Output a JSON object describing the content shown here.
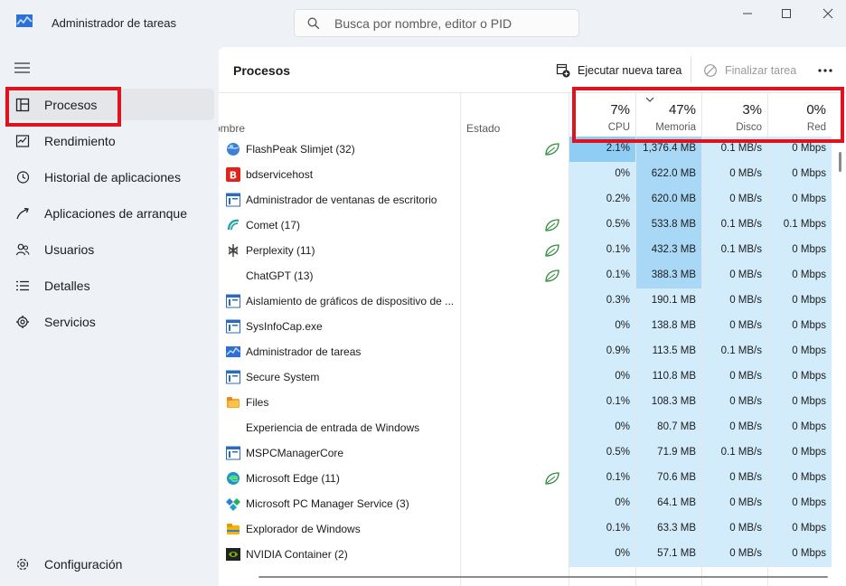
{
  "window": {
    "title": "Administrador de tareas",
    "search_placeholder": "Busca por nombre, editor o PID"
  },
  "sidebar": {
    "items": [
      {
        "label": "Procesos",
        "icon": "processes-icon",
        "active": true
      },
      {
        "label": "Rendimiento",
        "icon": "performance-icon"
      },
      {
        "label": "Historial de aplicaciones",
        "icon": "history-icon"
      },
      {
        "label": "Aplicaciones de arranque",
        "icon": "startup-icon"
      },
      {
        "label": "Usuarios",
        "icon": "users-icon"
      },
      {
        "label": "Detalles",
        "icon": "details-icon"
      },
      {
        "label": "Servicios",
        "icon": "services-icon"
      }
    ],
    "settings_label": "Configuración"
  },
  "toolbar": {
    "title": "Procesos",
    "run_task": "Ejecutar nueva tarea",
    "end_task": "Finalizar tarea"
  },
  "columns": {
    "name": "ombre",
    "status": "Estado",
    "cpu": {
      "pct": "7%",
      "label": "CPU"
    },
    "memory": {
      "pct": "47%",
      "label": "Memoria"
    },
    "disk": {
      "pct": "3%",
      "label": "Disco"
    },
    "network": {
      "pct": "0%",
      "label": "Red"
    }
  },
  "colors": {
    "highlight": "#e0121e",
    "heat_light": "#d3ecfb",
    "heat_mid": "#a9d8f6",
    "heat_strong": "#90cdf4",
    "efficiency_leaf": "#2f8a3c"
  },
  "processes": [
    {
      "name": "FlashPeak Slimjet (32)",
      "icon": "slimjet-globe-icon",
      "eco": true,
      "cpu": "2.1%",
      "mem": "1,376.4 MB",
      "disk": "0.1 MB/s",
      "net": "0 Mbps"
    },
    {
      "name": "bdservicehost",
      "icon": "bitdefender-icon",
      "eco": false,
      "cpu": "0%",
      "mem": "622.0 MB",
      "disk": "0 MB/s",
      "net": "0 Mbps"
    },
    {
      "name": "Administrador de ventanas de escritorio",
      "icon": "window-app-icon",
      "eco": false,
      "cpu": "0.2%",
      "mem": "620.0 MB",
      "disk": "0 MB/s",
      "net": "0 Mbps"
    },
    {
      "name": "Comet (17)",
      "icon": "comet-icon",
      "eco": true,
      "cpu": "0.5%",
      "mem": "533.8 MB",
      "disk": "0.1 MB/s",
      "net": "0.1 Mbps"
    },
    {
      "name": "Perplexity (11)",
      "icon": "perplexity-icon",
      "eco": true,
      "cpu": "0.1%",
      "mem": "432.3 MB",
      "disk": "0.1 MB/s",
      "net": "0 Mbps"
    },
    {
      "name": "ChatGPT (13)",
      "icon": "",
      "eco": true,
      "cpu": "0.1%",
      "mem": "388.3 MB",
      "disk": "0 MB/s",
      "net": "0 Mbps"
    },
    {
      "name": "Aislamiento de gráficos de dispositivo de ...",
      "icon": "window-app-icon",
      "eco": false,
      "cpu": "0.3%",
      "mem": "190.1 MB",
      "disk": "0 MB/s",
      "net": "0 Mbps"
    },
    {
      "name": "SysInfoCap.exe",
      "icon": "window-app-icon",
      "eco": false,
      "cpu": "0%",
      "mem": "138.8 MB",
      "disk": "0 MB/s",
      "net": "0 Mbps"
    },
    {
      "name": "Administrador de tareas",
      "icon": "task-manager-icon",
      "eco": false,
      "cpu": "0.9%",
      "mem": "113.5 MB",
      "disk": "0.1 MB/s",
      "net": "0 Mbps"
    },
    {
      "name": "Secure System",
      "icon": "window-app-icon",
      "eco": false,
      "cpu": "0%",
      "mem": "110.8 MB",
      "disk": "0 MB/s",
      "net": "0 Mbps"
    },
    {
      "name": "Files",
      "icon": "files-folder-icon",
      "eco": false,
      "cpu": "0.1%",
      "mem": "108.3 MB",
      "disk": "0 MB/s",
      "net": "0 Mbps"
    },
    {
      "name": "Experiencia de entrada de Windows",
      "icon": "",
      "eco": false,
      "cpu": "0%",
      "mem": "80.7 MB",
      "disk": "0 MB/s",
      "net": "0 Mbps"
    },
    {
      "name": "MSPCManagerCore",
      "icon": "window-app-icon",
      "eco": false,
      "cpu": "0.5%",
      "mem": "71.9 MB",
      "disk": "0.1 MB/s",
      "net": "0 Mbps"
    },
    {
      "name": "Microsoft Edge (11)",
      "icon": "edge-icon",
      "eco": true,
      "cpu": "0.1%",
      "mem": "70.6 MB",
      "disk": "0 MB/s",
      "net": "0 Mbps"
    },
    {
      "name": "Microsoft PC Manager Service (3)",
      "icon": "pc-manager-icon",
      "eco": false,
      "cpu": "0%",
      "mem": "64.1 MB",
      "disk": "0 MB/s",
      "net": "0 Mbps"
    },
    {
      "name": "Explorador de Windows",
      "icon": "explorer-folder-icon",
      "eco": false,
      "cpu": "0.1%",
      "mem": "63.3 MB",
      "disk": "0 MB/s",
      "net": "0 Mbps"
    },
    {
      "name": "NVIDIA Container (2)",
      "icon": "nvidia-icon",
      "eco": false,
      "cpu": "0%",
      "mem": "57.1 MB",
      "disk": "0 MB/s",
      "net": "0 Mbps"
    }
  ]
}
